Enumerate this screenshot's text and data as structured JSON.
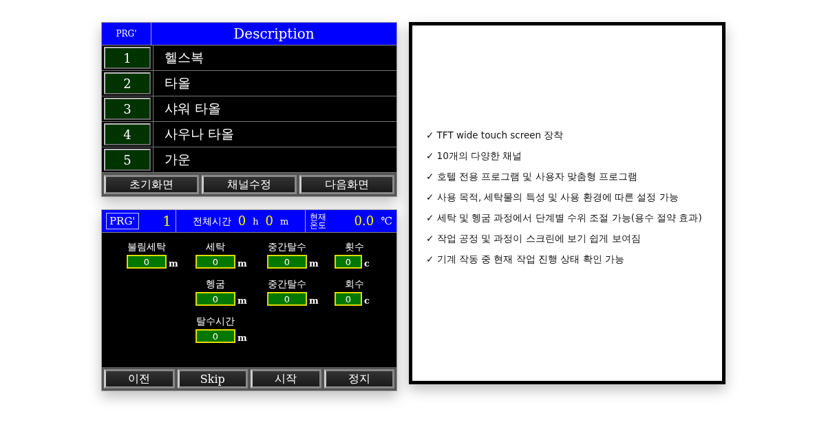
{
  "program_list": {
    "header": {
      "prg": "PRG'",
      "description": "Description"
    },
    "rows": [
      {
        "number": "1",
        "description": "헬스복"
      },
      {
        "number": "2",
        "description": "타올"
      },
      {
        "number": "3",
        "description": "샤워 타올"
      },
      {
        "number": "4",
        "description": "사우나 타올"
      },
      {
        "number": "5",
        "description": "가운"
      }
    ],
    "buttons": [
      "초기화면",
      "채널수정",
      "다음화면"
    ]
  },
  "run_screen": {
    "header": {
      "prg": "PRG'",
      "prg_value": "1",
      "total_time_label": "전체시간",
      "hours": "0",
      "hours_unit": "h",
      "minutes": "0",
      "minutes_unit": "m",
      "temp_label": "현재\n온도",
      "temp": "0.0",
      "temp_unit": "℃"
    },
    "grid": [
      [
        {
          "kind": "field",
          "label": "불림세탁",
          "value": "0",
          "unit": "m"
        },
        {
          "kind": "field",
          "label": "세탁",
          "value": "0",
          "unit": "m"
        },
        {
          "kind": "field",
          "label": "중간탈수",
          "value": "0",
          "unit": "m"
        },
        {
          "kind": "field",
          "label": "횟수",
          "value": "0",
          "unit": "c"
        }
      ],
      [
        {
          "kind": "blank"
        },
        {
          "kind": "field",
          "label": "헹굼",
          "value": "0",
          "unit": "m"
        },
        {
          "kind": "field",
          "label": "중간탈수",
          "value": "0",
          "unit": "m"
        },
        {
          "kind": "field",
          "label": "회수",
          "value": "0",
          "unit": "c"
        }
      ],
      [
        {
          "kind": "blank"
        },
        {
          "kind": "field",
          "label": "탈수시간",
          "value": "0",
          "unit": "m"
        },
        {
          "kind": "blank"
        },
        {
          "kind": "blank"
        }
      ]
    ],
    "buttons": [
      "이전",
      "Skip",
      "시작",
      "정지"
    ]
  },
  "features": [
    "✓ TFT wide touch screen 장착",
    "✓ 10개의 다양한 채널",
    "✓ 호텔 전용 프로그램 및 사용자 맞춤형 프로그램",
    "✓ 사용 목적, 세탁물의 특성 및 사용 환경에 따른 설정 가능",
    "✓ 세탁 및 헹굼 과정에서 단계별 수위 조절 가능(용수 절약 효과)",
    "✓ 작업 공정 및 과정이 스크린에 보기 쉽게 보여짐",
    "✓ 기계 작동 중 현재 작업 진행 상태 확인 가능"
  ]
}
